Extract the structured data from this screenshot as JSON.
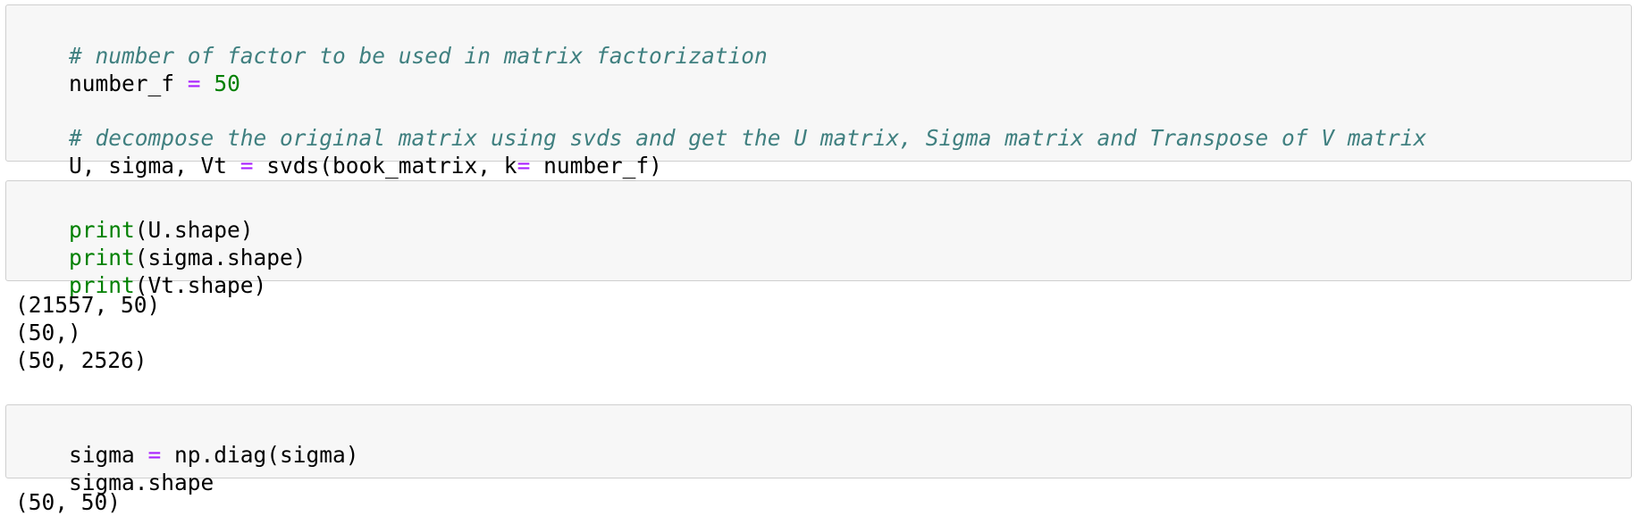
{
  "cells": [
    {
      "lines": [
        [
          {
            "t": "# number of factor to be used in matrix factorization",
            "k": "cm"
          }
        ],
        [
          {
            "t": "number_f ",
            "k": "tx"
          },
          {
            "t": "=",
            "k": "op"
          },
          {
            "t": " ",
            "k": "tx"
          },
          {
            "t": "50",
            "k": "num"
          }
        ],
        [],
        [
          {
            "t": "# decompose the original matrix using svds and get the U matrix, Sigma matrix and Transpose of V matrix",
            "k": "cm"
          }
        ],
        [
          {
            "t": "U, sigma, Vt ",
            "k": "tx"
          },
          {
            "t": "=",
            "k": "op"
          },
          {
            "t": " svds(book_matrix, k",
            "k": "tx"
          },
          {
            "t": "=",
            "k": "op"
          },
          {
            "t": " number_f)",
            "k": "tx"
          }
        ]
      ],
      "output": []
    },
    {
      "lines": [
        [
          {
            "t": "print",
            "k": "bi"
          },
          {
            "t": "(U.shape)",
            "k": "tx"
          }
        ],
        [
          {
            "t": "print",
            "k": "bi"
          },
          {
            "t": "(sigma.shape)",
            "k": "tx"
          }
        ],
        [
          {
            "t": "print",
            "k": "bi"
          },
          {
            "t": "(Vt.shape)",
            "k": "tx"
          }
        ]
      ],
      "output": [
        "(21557, 50)",
        "(50,)",
        "(50, 2526)"
      ]
    },
    {
      "lines": [
        [
          {
            "t": "sigma ",
            "k": "tx"
          },
          {
            "t": "=",
            "k": "op"
          },
          {
            "t": " np.diag(sigma)",
            "k": "tx"
          }
        ],
        [
          {
            "t": "sigma.shape",
            "k": "tx"
          }
        ]
      ],
      "output": [
        "(50, 50)"
      ]
    }
  ]
}
